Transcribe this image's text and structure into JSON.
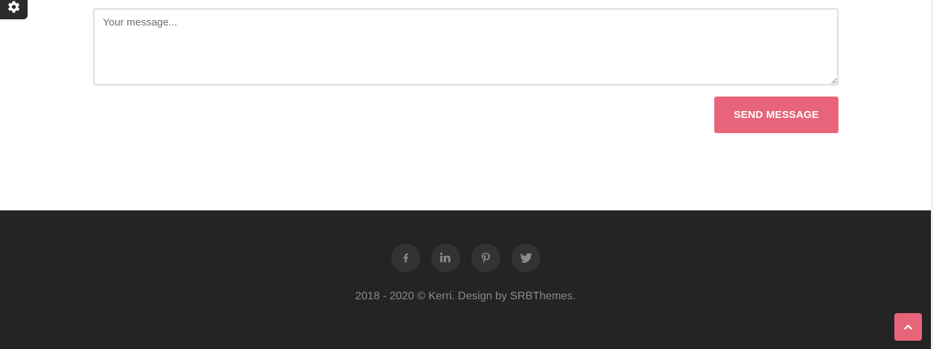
{
  "contact_form": {
    "message_placeholder": "Your message...",
    "message_value": "",
    "send_label": "SEND MESSAGE"
  },
  "footer": {
    "social": [
      {
        "name": "facebook",
        "icon": "facebook-icon"
      },
      {
        "name": "linkedin",
        "icon": "linkedin-icon"
      },
      {
        "name": "pinterest",
        "icon": "pinterest-icon"
      },
      {
        "name": "twitter",
        "icon": "twitter-icon"
      }
    ],
    "copyright": "2018 - 2020 © Kerri. Design by SRBThemes."
  },
  "widgets": {
    "settings_icon": "gear-icon",
    "back_to_top_icon": "chevron-up-icon"
  },
  "colors": {
    "accent": "#e8647a",
    "footer_bg": "#242424",
    "social_bg": "#333333",
    "footer_text": "#8a8a8a"
  }
}
